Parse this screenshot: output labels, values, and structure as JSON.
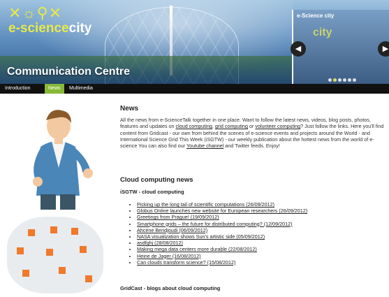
{
  "banner": {
    "logo_glyphs": "✕☼⚲✕",
    "logo_word_a": "e-science",
    "logo_word_b": "city",
    "title": "Communication Centre"
  },
  "carousel": {
    "title": "e-Science city",
    "image_text": "city",
    "slide_count": 6,
    "active_slide": 1
  },
  "nav": {
    "items": [
      {
        "label": "Introduction",
        "active": false
      },
      {
        "label": "News",
        "active": true
      },
      {
        "label": "Multimedia",
        "active": false
      }
    ]
  },
  "news": {
    "heading": "News",
    "p1": "All the news from e-ScienceTalk together in one place. Want to follow the latest news, videos, blog posts, photos, features and updates on ",
    "link_cloud": "cloud computing",
    "p2": ", ",
    "link_grid": "grid computing",
    "p3": " or ",
    "link_volunteer": "volunteer computing",
    "p4": "? Just follow the links. Here you'll find content from Gridcast - our own from behind the scenes of e-science events and projects around the World - and International Science Grid This Week (iSGTW) - our weekly publication about the hottest news from the world of e-science You can also find our ",
    "link_youtube": "Youtube channel",
    "p5": " and Twitter feeds. Enjoy!"
  },
  "cloud": {
    "heading": "Cloud computing news",
    "isgtw_heading": "iSGTW - cloud computing",
    "links": [
      "Picking up the long tail of scientific computations (26/09/2012)",
      "Globus Online launches new website for European researchers (26/09/2012)",
      "Greetings from Prague! (19/09/2012)",
      "Smartphone grids – the future for distributed computing? (12/09/2012)",
      "Ahcène Bendjoudi (06/09/2012)",
      "NASA visualization shows Sun's artistic side (05/09/2012)",
      "asdfghj (28/08/2012)",
      "Making mega data centers more durable (22/08/2012)",
      "Heine de Jager (16/08/2012)",
      "Can clouds transform science? (15/08/2012)"
    ],
    "gridcast_heading": "GridCast - blogs about cloud computing"
  },
  "colors": {
    "nav_active": "#86b936",
    "logo_accent": "#e6e94a",
    "map_plots": "#f0792b"
  }
}
